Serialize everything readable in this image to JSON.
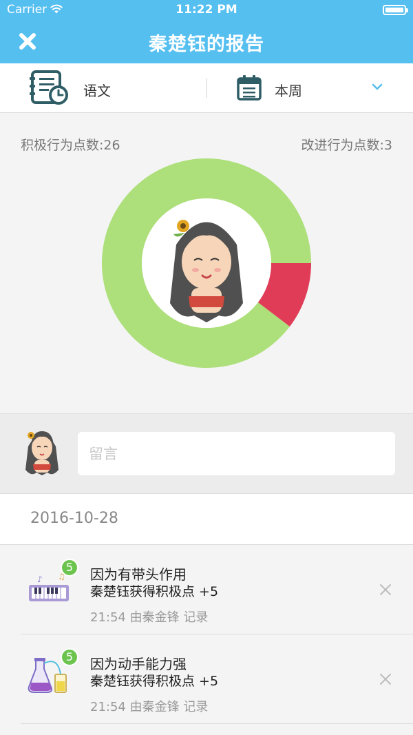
{
  "status_bar": {
    "carrier": "Carrier",
    "time": "11:22 PM"
  },
  "nav": {
    "title": "秦楚钰的报告"
  },
  "filters": {
    "subject": "语文",
    "period": "本周"
  },
  "stats": {
    "positive_label": "积极行为点数:26",
    "improve_label": "改进行为点数:3",
    "positive_count": 26,
    "improve_count": 3,
    "positive_color": "#addf7a",
    "improve_color": "#e03c58"
  },
  "comment": {
    "placeholder": "留言"
  },
  "date": "2016-10-28",
  "records": [
    {
      "icon": "piano-icon",
      "badge": "5",
      "reason": "因为有带头作用",
      "result": "秦楚钰获得积极点 +5",
      "meta": "21:54 由秦金锋 记录"
    },
    {
      "icon": "chemistry-flask-icon",
      "badge": "5",
      "reason": "因为动手能力强",
      "result": "秦楚钰获得积极点 +5",
      "meta": "21:54 由秦金锋 记录"
    }
  ],
  "colors": {
    "accent": "#55bff0",
    "badge": "#6cc44f"
  }
}
